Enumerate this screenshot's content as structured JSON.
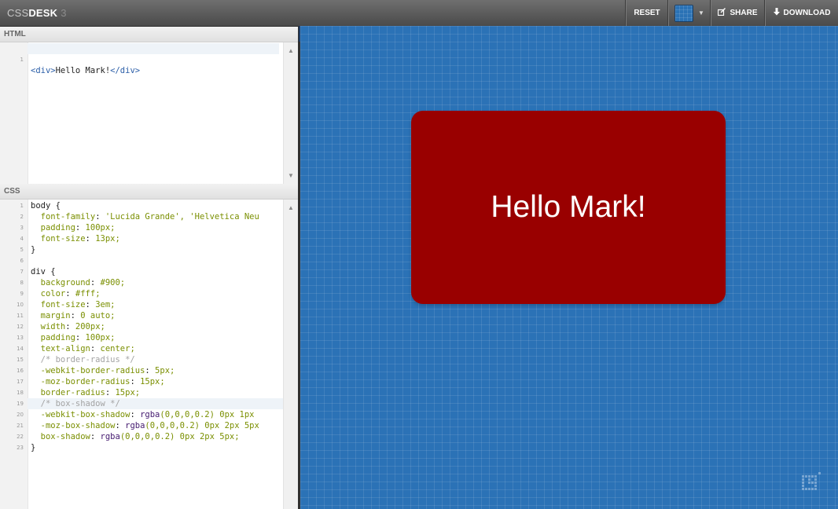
{
  "app": {
    "logo_prefix": "CSS",
    "logo_main": "DESK",
    "logo_suffix": "3"
  },
  "toolbar": {
    "reset": "RESET",
    "theme_icon": "grid-swatch-icon",
    "share": "SHARE",
    "share_icon": "edit-icon",
    "download": "DOWNLOAD",
    "download_icon": "download-icon"
  },
  "html_pane": {
    "title": "HTML",
    "lines": [
      {
        "n": "1",
        "open": "<div>",
        "text": "Hello Mark!",
        "close": "</div>"
      }
    ]
  },
  "css_pane": {
    "title": "CSS",
    "lines": [
      {
        "n": "1",
        "text": "body {"
      },
      {
        "n": "2",
        "text": "  font-family: 'Lucida Grande', 'Helvetica Neu"
      },
      {
        "n": "3",
        "text": "  padding: 100px;"
      },
      {
        "n": "4",
        "text": "  font-size: 13px;"
      },
      {
        "n": "5",
        "text": "}"
      },
      {
        "n": "6",
        "text": ""
      },
      {
        "n": "7",
        "text": "div {"
      },
      {
        "n": "8",
        "text": "  background: #900;"
      },
      {
        "n": "9",
        "text": "  color: #fff;"
      },
      {
        "n": "10",
        "text": "  font-size: 3em;"
      },
      {
        "n": "11",
        "text": "  margin: 0 auto;"
      },
      {
        "n": "12",
        "text": "  width: 200px;"
      },
      {
        "n": "13",
        "text": "  padding: 100px;"
      },
      {
        "n": "14",
        "text": "  text-align: center;"
      },
      {
        "n": "15",
        "text": "  /* border-radius */"
      },
      {
        "n": "16",
        "text": "  -webkit-border-radius: 5px;"
      },
      {
        "n": "17",
        "text": "  -moz-border-radius: 15px;"
      },
      {
        "n": "18",
        "text": "  border-radius: 15px;"
      },
      {
        "n": "19",
        "text": "  /* box-shadow */"
      },
      {
        "n": "20",
        "text": "  -webkit-box-shadow: rgba(0,0,0,0.2) 0px 1px"
      },
      {
        "n": "21",
        "text": "  -moz-box-shadow: rgba(0,0,0,0.2) 0px 2px 5px"
      },
      {
        "n": "22",
        "text": "  box-shadow: rgba(0,0,0,0.2) 0px 2px 5px;"
      },
      {
        "n": "23",
        "text": "}"
      }
    ]
  },
  "preview": {
    "content": "Hello Mark!",
    "box_color": "#990000",
    "background_color": "#2b72b6",
    "corner_icon": "grid-logo-icon"
  }
}
